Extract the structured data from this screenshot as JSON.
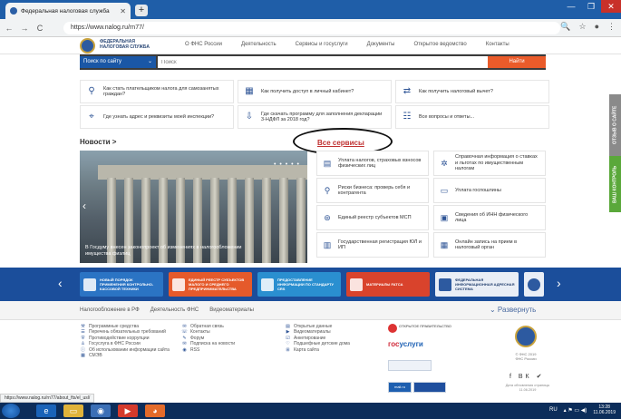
{
  "browser": {
    "tab_title": "Федеральная налоговая служба",
    "tab_close": "✕",
    "new_tab": "+",
    "back": "←",
    "forward": "→",
    "reload": "C",
    "url": "https://www.nalog.ru/rn77/",
    "window_min": "—",
    "window_max": "❐",
    "window_close": "✕",
    "zoom_icon": "🔍",
    "star_icon": "☆",
    "account_icon": "●",
    "menu_icon": "⋮"
  },
  "site": {
    "logo_text": "ФЕДЕРАЛЬНАЯ НАЛОГОВАЯ СЛУЖБА",
    "nav": [
      "О ФНС России",
      "Деятельность",
      "Сервисы и госуслуги",
      "Документы",
      "Открытое ведомство",
      "Контакты"
    ]
  },
  "search": {
    "scope_label": "Поиск по сайту",
    "chevron": "⌄",
    "placeholder": "Поиск",
    "button": "Найти"
  },
  "questions": [
    "Как стать плательщиком налога для самозанятых граждан?",
    "Как получить доступ в личный кабинет?",
    "Как получить налоговый вычет?",
    "Где узнать адрес и реквизиты моей инспекции?",
    "Где скачать программу для заполнения декларации 3-НДФЛ за 2018 год?",
    "Все вопросы и ответы..."
  ],
  "news": {
    "title": "Новости >",
    "caption": "В Госдуму внесен законопроект об изменениях в налогообложении имущества физлиц",
    "dots": "• • • • •",
    "arrow": "‹"
  },
  "all_services": "Все сервисы",
  "services": [
    "Уплата налогов, страховых взносов физических лиц",
    "Справочная информация о ставках и льготах по имущественным налогам",
    "Риски бизнеса: проверь себя и контрагента",
    "Уплата госпошлины",
    "Единый реестр субъектов МСП",
    "Сведения об ИНН физического лица",
    "Государственная регистрация ЮЛ и ИП",
    "Онлайн запись на прием в налоговый орган"
  ],
  "side_tabs": {
    "feedback": "ОТЗЫВ О САЙТЕ",
    "control": "ВАШ КОНТРОЛЬ"
  },
  "banners": [
    "НОВЫЙ ПОРЯДОК ПРИМЕНЕНИЯ КОНТРОЛЬНО-КАССОВОЙ ТЕХНИКИ",
    "ЕДИНЫЙ РЕЕСТР СУБЪЕКТОВ МАЛОГО И СРЕДНЕГО ПРЕДПРИНИМАТЕЛЬСТВА",
    "ПРЕДОСТАВЛЕНИЕ ИНФОРМАЦИИ ПО СТАНДАРТУ CRS",
    "МАТЕРИАЛЫ FATCA",
    "ФЕДЕРАЛЬНАЯ ИНФОРМАЦИОННАЯ АДРЕСНАЯ СИСТЕМА"
  ],
  "banner_prev": "‹",
  "banner_next": "›",
  "links_bar": {
    "items": [
      "Налогообложение в РФ",
      "Деятельность ФНС",
      "Видеоматериалы"
    ],
    "expand": "⌄ Развернуть"
  },
  "footer": {
    "col1": [
      "Программные средства",
      "Перечень обязательных требований",
      "Противодействие коррупции",
      "Госуслуга в ФНС России",
      "Об использовании информации сайта",
      "СМЭВ"
    ],
    "col2": [
      "Обратная связь",
      "Контакты",
      "Форум",
      "Подписка на новости",
      "RSS"
    ],
    "col3": [
      "Открытые данные",
      "Видеоматериалы",
      "Анкетирование",
      "Подшефные детские дома",
      "Карта сайта"
    ],
    "otkr_label": "ОТКРЫТОЕ ПРАВИТЕЛЬСТВО",
    "gosusl_a": "гос",
    "gosusl_b": "услуги",
    "badge1": "",
    "badge2": "mail.ru",
    "badge3": "",
    "copyright": "© ФНС 2019",
    "fns_label": "ФНС России",
    "social": "f ВК ✔",
    "updated": "Дата обновления страницы 11.06.2019"
  },
  "status_url": "https://www.nalog.ru/rn77/about_fts/el_usl/",
  "taskbar": {
    "lang": "RU",
    "time": "13:28",
    "date": "11.06.2019"
  }
}
